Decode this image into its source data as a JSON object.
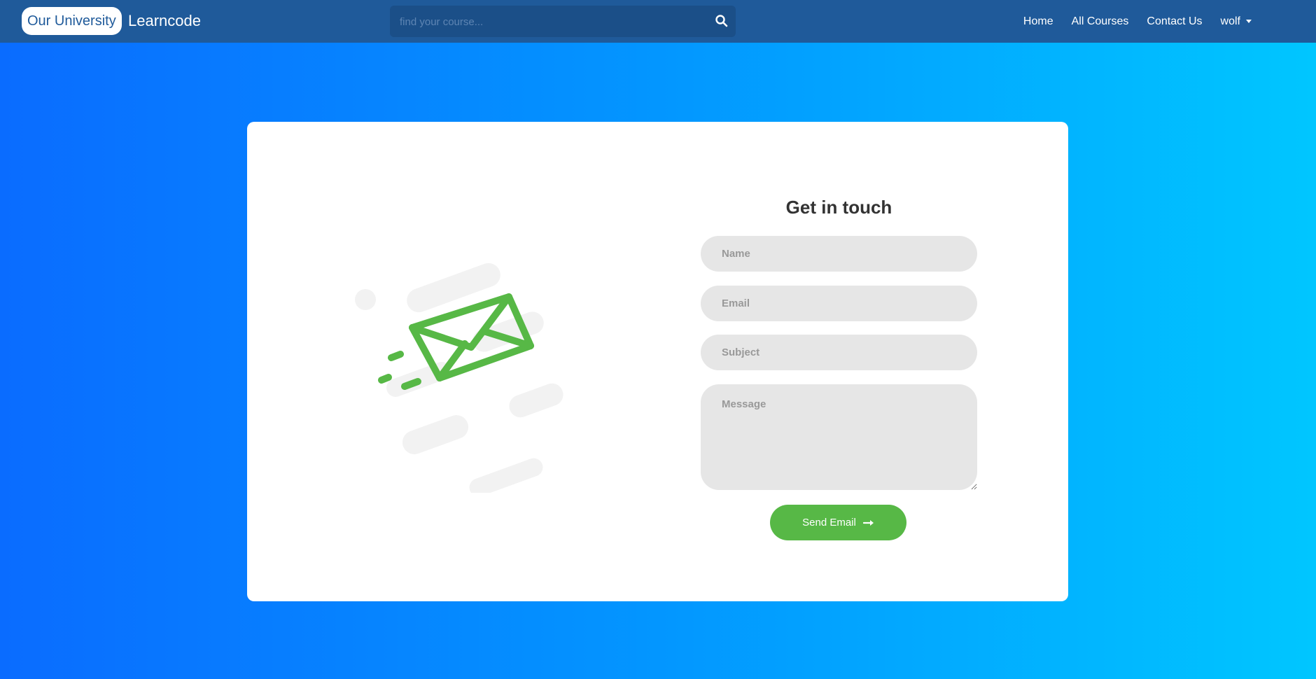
{
  "navbar": {
    "brand_pill": "Our University",
    "brand_text": "Learncode",
    "search": {
      "placeholder": "find your course...",
      "value": ""
    },
    "links": [
      {
        "label": "Home"
      },
      {
        "label": "All Courses"
      },
      {
        "label": "Contact Us"
      }
    ],
    "user_menu": {
      "label": "wolf"
    }
  },
  "contact_form": {
    "title": "Get in touch",
    "fields": {
      "name": {
        "placeholder": "Name",
        "value": ""
      },
      "email": {
        "placeholder": "Email",
        "value": ""
      },
      "subject": {
        "placeholder": "Subject",
        "value": ""
      },
      "message": {
        "placeholder": "Message",
        "value": ""
      }
    },
    "submit_label": "Send Email"
  },
  "icons": {
    "search": "search-icon",
    "envelope": "envelope-illustration",
    "arrow": "arrow-right-icon",
    "caret": "caret-down-icon"
  },
  "colors": {
    "navbar": "#1f5a9a",
    "accent_green": "#57b846",
    "field_bg": "#e6e6e6",
    "gradient_start": "#0a6cff",
    "gradient_end": "#00c6ff"
  }
}
